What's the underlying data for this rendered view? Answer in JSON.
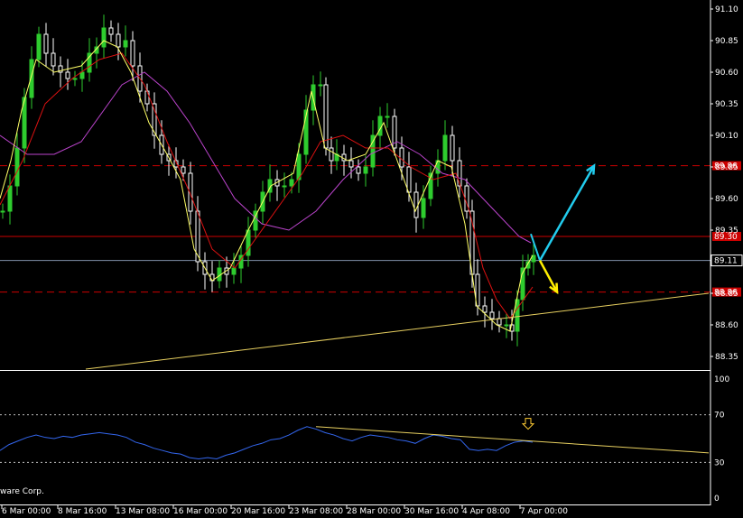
{
  "colors": {
    "background": "#000000",
    "axis": "#ffffff",
    "grid": "#bfbfbf",
    "candle_up": "#2ecc2e",
    "candle_down": "#ffffff",
    "ma_fast": "#ffff66",
    "ma_mid": "#dd1111",
    "ma_slow": "#bb44cc",
    "rsi": "#3366ee",
    "level_line": "#cc0000",
    "trendline": "#e8d060",
    "current_price_line": "#7f8fa8",
    "arrow_up": "#22ccee",
    "arrow_down": "#ffee00",
    "signal_arrow": "#ffcc33"
  },
  "footer": {
    "copyright": "ware Corp."
  },
  "chart_data": [
    {
      "type": "candlestick",
      "title": "",
      "price_axis": {
        "range": [
          88.25,
          91.15
        ],
        "ticks": [
          "91.10",
          "90.85",
          "90.60",
          "90.35",
          "90.10",
          "89.85",
          "89.60",
          "89.35",
          "89.11",
          "88.85",
          "88.60",
          "88.35"
        ]
      },
      "current_price": "89.11",
      "levels": [
        {
          "label": "89.86",
          "value": 89.86,
          "style": "dashed"
        },
        {
          "label": "89.30",
          "value": 89.3,
          "style": "solid"
        },
        {
          "label": "88.86",
          "value": 88.86,
          "style": "dashed"
        }
      ],
      "x_labels": [
        "6 Mar 00:00",
        "8 Mar 16:00",
        "13 Mar 08:00",
        "16 Mar 00:00",
        "20 Mar 16:00",
        "23 Mar 08:00",
        "28 Mar 00:00",
        "30 Mar 16:00",
        "4 Apr 08:00",
        "7 Apr 00:00"
      ],
      "close_series": [
        [
          0,
          89.5
        ],
        [
          8,
          89.7
        ],
        [
          16,
          90.0
        ],
        [
          24,
          90.4
        ],
        [
          32,
          90.7
        ],
        [
          40,
          90.9
        ],
        [
          48,
          90.75
        ],
        [
          56,
          90.65
        ],
        [
          64,
          90.6
        ],
        [
          72,
          90.55
        ],
        [
          80,
          90.55
        ],
        [
          88,
          90.6
        ],
        [
          96,
          90.75
        ],
        [
          104,
          90.8
        ],
        [
          112,
          90.95
        ],
        [
          120,
          90.9
        ],
        [
          128,
          90.8
        ],
        [
          136,
          90.85
        ],
        [
          144,
          90.65
        ],
        [
          152,
          90.45
        ],
        [
          160,
          90.35
        ],
        [
          168,
          90.1
        ],
        [
          176,
          89.95
        ],
        [
          184,
          89.9
        ],
        [
          192,
          89.85
        ],
        [
          200,
          89.8
        ],
        [
          208,
          89.5
        ],
        [
          216,
          89.1
        ],
        [
          224,
          89.0
        ],
        [
          232,
          88.95
        ],
        [
          240,
          89.05
        ],
        [
          248,
          89.0
        ],
        [
          256,
          89.05
        ],
        [
          264,
          89.15
        ],
        [
          272,
          89.35
        ],
        [
          280,
          89.5
        ],
        [
          288,
          89.65
        ],
        [
          296,
          89.75
        ],
        [
          304,
          89.7
        ],
        [
          312,
          89.7
        ],
        [
          320,
          89.75
        ],
        [
          328,
          89.95
        ],
        [
          336,
          90.3
        ],
        [
          344,
          90.5
        ],
        [
          352,
          90.5
        ],
        [
          358,
          90.0
        ],
        [
          364,
          89.9
        ],
        [
          370,
          89.95
        ],
        [
          378,
          89.9
        ],
        [
          386,
          89.85
        ],
        [
          394,
          89.8
        ],
        [
          402,
          89.85
        ],
        [
          410,
          90.1
        ],
        [
          418,
          90.25
        ],
        [
          426,
          90.25
        ],
        [
          434,
          90.0
        ],
        [
          442,
          89.85
        ],
        [
          450,
          89.65
        ],
        [
          458,
          89.45
        ],
        [
          466,
          89.6
        ],
        [
          474,
          89.8
        ],
        [
          482,
          89.9
        ],
        [
          490,
          90.1
        ],
        [
          498,
          89.9
        ],
        [
          506,
          89.7
        ],
        [
          514,
          89.5
        ],
        [
          520,
          89.0
        ],
        [
          526,
          88.75
        ],
        [
          534,
          88.7
        ],
        [
          542,
          88.65
        ],
        [
          550,
          88.6
        ],
        [
          558,
          88.6
        ],
        [
          564,
          88.55
        ],
        [
          570,
          88.8
        ],
        [
          576,
          89.05
        ],
        [
          582,
          89.1
        ],
        [
          588,
          89.15
        ]
      ],
      "ma_fast": [
        [
          0,
          89.6
        ],
        [
          12,
          89.9
        ],
        [
          24,
          90.3
        ],
        [
          40,
          90.7
        ],
        [
          60,
          90.6
        ],
        [
          90,
          90.65
        ],
        [
          115,
          90.85
        ],
        [
          130,
          90.8
        ],
        [
          145,
          90.6
        ],
        [
          165,
          90.2
        ],
        [
          185,
          89.95
        ],
        [
          200,
          89.75
        ],
        [
          215,
          89.2
        ],
        [
          235,
          88.95
        ],
        [
          255,
          89.05
        ],
        [
          275,
          89.35
        ],
        [
          300,
          89.7
        ],
        [
          325,
          89.8
        ],
        [
          345,
          90.45
        ],
        [
          360,
          90.0
        ],
        [
          385,
          89.9
        ],
        [
          405,
          89.95
        ],
        [
          425,
          90.2
        ],
        [
          445,
          89.8
        ],
        [
          460,
          89.5
        ],
        [
          485,
          89.9
        ],
        [
          500,
          89.85
        ],
        [
          515,
          89.4
        ],
        [
          528,
          88.75
        ],
        [
          550,
          88.6
        ],
        [
          565,
          88.55
        ],
        [
          578,
          89.0
        ],
        [
          590,
          89.15
        ]
      ],
      "ma_mid": [
        [
          0,
          89.55
        ],
        [
          25,
          89.9
        ],
        [
          50,
          90.35
        ],
        [
          80,
          90.55
        ],
        [
          110,
          90.7
        ],
        [
          135,
          90.75
        ],
        [
          160,
          90.5
        ],
        [
          185,
          90.05
        ],
        [
          210,
          89.65
        ],
        [
          235,
          89.2
        ],
        [
          260,
          89.05
        ],
        [
          285,
          89.3
        ],
        [
          310,
          89.55
        ],
        [
          335,
          89.8
        ],
        [
          355,
          90.05
        ],
        [
          380,
          90.1
        ],
        [
          405,
          90.0
        ],
        [
          430,
          90.0
        ],
        [
          455,
          89.85
        ],
        [
          480,
          89.75
        ],
        [
          505,
          89.8
        ],
        [
          520,
          89.5
        ],
        [
          535,
          89.05
        ],
        [
          550,
          88.8
        ],
        [
          565,
          88.65
        ],
        [
          580,
          88.8
        ],
        [
          590,
          88.9
        ]
      ],
      "ma_slow": [
        [
          0,
          90.1
        ],
        [
          30,
          89.95
        ],
        [
          60,
          89.95
        ],
        [
          90,
          90.05
        ],
        [
          115,
          90.3
        ],
        [
          135,
          90.5
        ],
        [
          160,
          90.6
        ],
        [
          185,
          90.45
        ],
        [
          210,
          90.2
        ],
        [
          235,
          89.9
        ],
        [
          260,
          89.6
        ],
        [
          290,
          89.4
        ],
        [
          320,
          89.35
        ],
        [
          350,
          89.5
        ],
        [
          380,
          89.75
        ],
        [
          410,
          89.95
        ],
        [
          440,
          90.05
        ],
        [
          465,
          89.95
        ],
        [
          490,
          89.8
        ],
        [
          515,
          89.75
        ],
        [
          535,
          89.6
        ],
        [
          555,
          89.45
        ],
        [
          575,
          89.3
        ],
        [
          588,
          89.25
        ]
      ],
      "trendline": {
        "from": [
          95,
          88.25
        ],
        "to": [
          785,
          88.85
        ]
      },
      "forecast_up": {
        "from": [
          598,
          89.11
        ],
        "to": [
          658,
          89.86
        ]
      },
      "forecast_down": {
        "from": [
          598,
          89.11
        ],
        "to": [
          617,
          88.86
        ]
      }
    },
    {
      "type": "line",
      "title": "",
      "indicator_axis": {
        "range": [
          0,
          100
        ],
        "ticks": [
          "100",
          "70",
          "30",
          "0"
        ]
      },
      "levels": [
        70,
        30
      ],
      "series": [
        {
          "values": [
            [
              0,
              40
            ],
            [
              10,
              45
            ],
            [
              20,
              48
            ],
            [
              30,
              51
            ],
            [
              40,
              53
            ],
            [
              50,
              51
            ],
            [
              60,
              50
            ],
            [
              70,
              52
            ],
            [
              80,
              51
            ],
            [
              90,
              53
            ],
            [
              100,
              54
            ],
            [
              110,
              55
            ],
            [
              120,
              54
            ],
            [
              130,
              53
            ],
            [
              140,
              51
            ],
            [
              150,
              47
            ],
            [
              160,
              45
            ],
            [
              170,
              42
            ],
            [
              180,
              40
            ],
            [
              190,
              38
            ],
            [
              200,
              37
            ],
            [
              210,
              34
            ],
            [
              220,
              33
            ],
            [
              230,
              34
            ],
            [
              240,
              33
            ],
            [
              250,
              36
            ],
            [
              260,
              38
            ],
            [
              270,
              41
            ],
            [
              280,
              44
            ],
            [
              290,
              46
            ],
            [
              300,
              49
            ],
            [
              310,
              50
            ],
            [
              320,
              53
            ],
            [
              330,
              57
            ],
            [
              340,
              60
            ],
            [
              350,
              58
            ],
            [
              360,
              55
            ],
            [
              370,
              53
            ],
            [
              380,
              50
            ],
            [
              390,
              48
            ],
            [
              400,
              51
            ],
            [
              410,
              53
            ],
            [
              420,
              52
            ],
            [
              430,
              51
            ],
            [
              440,
              49
            ],
            [
              450,
              48
            ],
            [
              460,
              46
            ],
            [
              470,
              50
            ],
            [
              480,
              53
            ],
            [
              490,
              52
            ],
            [
              500,
              50
            ],
            [
              510,
              49
            ],
            [
              520,
              41
            ],
            [
              530,
              40
            ],
            [
              540,
              41
            ],
            [
              550,
              40
            ],
            [
              560,
              44
            ],
            [
              570,
              47
            ],
            [
              580,
              48
            ],
            [
              590,
              47
            ]
          ]
        }
      ],
      "trendline": {
        "from": [
          350,
          60
        ],
        "to": [
          785,
          38
        ]
      },
      "signal_marker": {
        "x": 585
      }
    }
  ]
}
